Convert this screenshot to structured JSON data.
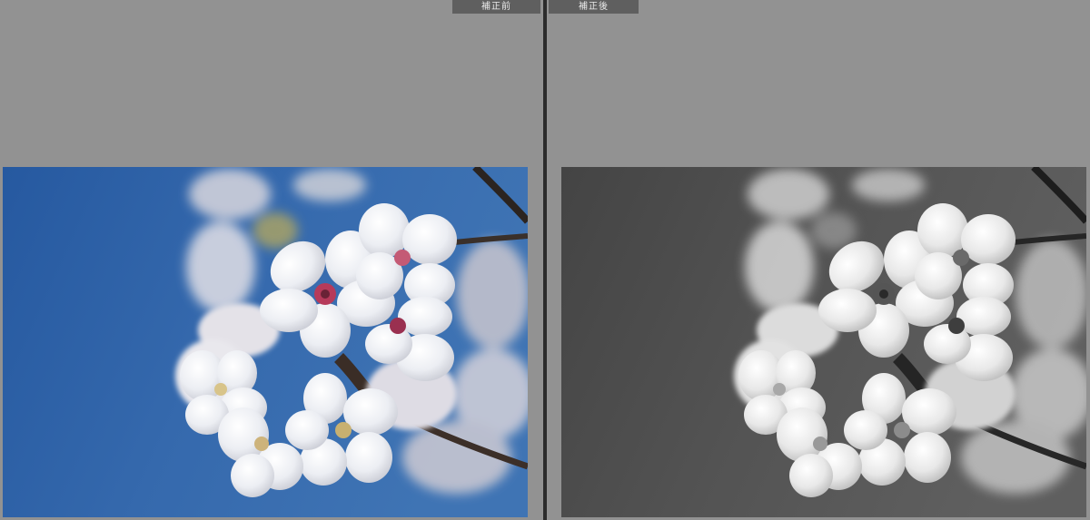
{
  "before": {
    "label": "補正前"
  },
  "after": {
    "label": "補正後"
  },
  "colors": {
    "workspace": "#929292",
    "divider": "#2b2b2b",
    "label_bg": "#5f5f5f",
    "sky_blue": "#2f64a8"
  },
  "icons": []
}
